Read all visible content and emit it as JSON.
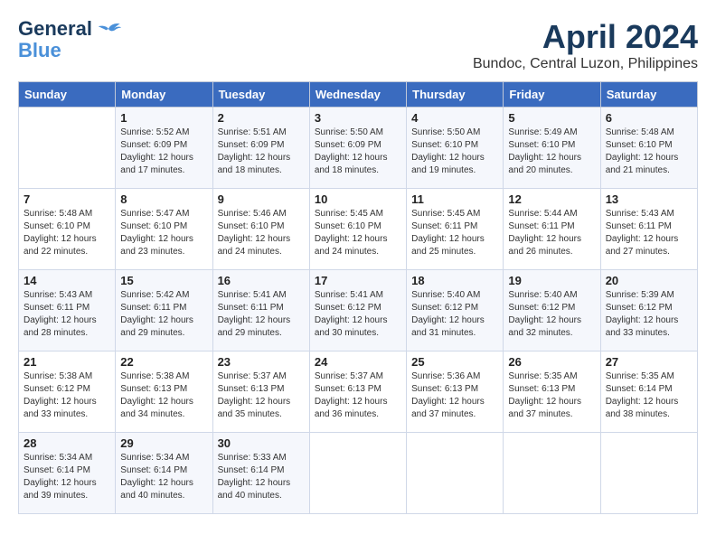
{
  "logo": {
    "line1": "General",
    "line2": "Blue"
  },
  "title": "April 2024",
  "subtitle": "Bundoc, Central Luzon, Philippines",
  "headers": [
    "Sunday",
    "Monday",
    "Tuesday",
    "Wednesday",
    "Thursday",
    "Friday",
    "Saturday"
  ],
  "weeks": [
    [
      {
        "day": "",
        "info": ""
      },
      {
        "day": "1",
        "info": "Sunrise: 5:52 AM\nSunset: 6:09 PM\nDaylight: 12 hours\nand 17 minutes."
      },
      {
        "day": "2",
        "info": "Sunrise: 5:51 AM\nSunset: 6:09 PM\nDaylight: 12 hours\nand 18 minutes."
      },
      {
        "day": "3",
        "info": "Sunrise: 5:50 AM\nSunset: 6:09 PM\nDaylight: 12 hours\nand 18 minutes."
      },
      {
        "day": "4",
        "info": "Sunrise: 5:50 AM\nSunset: 6:10 PM\nDaylight: 12 hours\nand 19 minutes."
      },
      {
        "day": "5",
        "info": "Sunrise: 5:49 AM\nSunset: 6:10 PM\nDaylight: 12 hours\nand 20 minutes."
      },
      {
        "day": "6",
        "info": "Sunrise: 5:48 AM\nSunset: 6:10 PM\nDaylight: 12 hours\nand 21 minutes."
      }
    ],
    [
      {
        "day": "7",
        "info": "Sunrise: 5:48 AM\nSunset: 6:10 PM\nDaylight: 12 hours\nand 22 minutes."
      },
      {
        "day": "8",
        "info": "Sunrise: 5:47 AM\nSunset: 6:10 PM\nDaylight: 12 hours\nand 23 minutes."
      },
      {
        "day": "9",
        "info": "Sunrise: 5:46 AM\nSunset: 6:10 PM\nDaylight: 12 hours\nand 24 minutes."
      },
      {
        "day": "10",
        "info": "Sunrise: 5:45 AM\nSunset: 6:10 PM\nDaylight: 12 hours\nand 24 minutes."
      },
      {
        "day": "11",
        "info": "Sunrise: 5:45 AM\nSunset: 6:11 PM\nDaylight: 12 hours\nand 25 minutes."
      },
      {
        "day": "12",
        "info": "Sunrise: 5:44 AM\nSunset: 6:11 PM\nDaylight: 12 hours\nand 26 minutes."
      },
      {
        "day": "13",
        "info": "Sunrise: 5:43 AM\nSunset: 6:11 PM\nDaylight: 12 hours\nand 27 minutes."
      }
    ],
    [
      {
        "day": "14",
        "info": "Sunrise: 5:43 AM\nSunset: 6:11 PM\nDaylight: 12 hours\nand 28 minutes."
      },
      {
        "day": "15",
        "info": "Sunrise: 5:42 AM\nSunset: 6:11 PM\nDaylight: 12 hours\nand 29 minutes."
      },
      {
        "day": "16",
        "info": "Sunrise: 5:41 AM\nSunset: 6:11 PM\nDaylight: 12 hours\nand 29 minutes."
      },
      {
        "day": "17",
        "info": "Sunrise: 5:41 AM\nSunset: 6:12 PM\nDaylight: 12 hours\nand 30 minutes."
      },
      {
        "day": "18",
        "info": "Sunrise: 5:40 AM\nSunset: 6:12 PM\nDaylight: 12 hours\nand 31 minutes."
      },
      {
        "day": "19",
        "info": "Sunrise: 5:40 AM\nSunset: 6:12 PM\nDaylight: 12 hours\nand 32 minutes."
      },
      {
        "day": "20",
        "info": "Sunrise: 5:39 AM\nSunset: 6:12 PM\nDaylight: 12 hours\nand 33 minutes."
      }
    ],
    [
      {
        "day": "21",
        "info": "Sunrise: 5:38 AM\nSunset: 6:12 PM\nDaylight: 12 hours\nand 33 minutes."
      },
      {
        "day": "22",
        "info": "Sunrise: 5:38 AM\nSunset: 6:13 PM\nDaylight: 12 hours\nand 34 minutes."
      },
      {
        "day": "23",
        "info": "Sunrise: 5:37 AM\nSunset: 6:13 PM\nDaylight: 12 hours\nand 35 minutes."
      },
      {
        "day": "24",
        "info": "Sunrise: 5:37 AM\nSunset: 6:13 PM\nDaylight: 12 hours\nand 36 minutes."
      },
      {
        "day": "25",
        "info": "Sunrise: 5:36 AM\nSunset: 6:13 PM\nDaylight: 12 hours\nand 37 minutes."
      },
      {
        "day": "26",
        "info": "Sunrise: 5:35 AM\nSunset: 6:13 PM\nDaylight: 12 hours\nand 37 minutes."
      },
      {
        "day": "27",
        "info": "Sunrise: 5:35 AM\nSunset: 6:14 PM\nDaylight: 12 hours\nand 38 minutes."
      }
    ],
    [
      {
        "day": "28",
        "info": "Sunrise: 5:34 AM\nSunset: 6:14 PM\nDaylight: 12 hours\nand 39 minutes."
      },
      {
        "day": "29",
        "info": "Sunrise: 5:34 AM\nSunset: 6:14 PM\nDaylight: 12 hours\nand 40 minutes."
      },
      {
        "day": "30",
        "info": "Sunrise: 5:33 AM\nSunset: 6:14 PM\nDaylight: 12 hours\nand 40 minutes."
      },
      {
        "day": "",
        "info": ""
      },
      {
        "day": "",
        "info": ""
      },
      {
        "day": "",
        "info": ""
      },
      {
        "day": "",
        "info": ""
      }
    ]
  ]
}
